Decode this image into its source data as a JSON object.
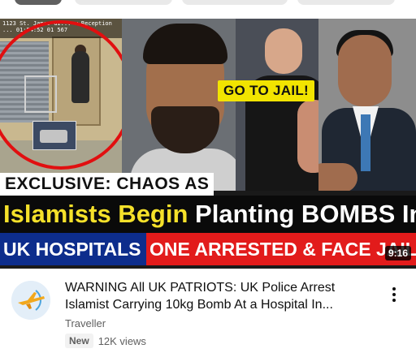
{
  "thumbnail": {
    "timestamp_overlay": "1123 St. James Gi... w Reception\n... 01:54:52 01 567",
    "speech_bubble": "GO TO JAIL!",
    "headline_line1": "EXCLUSIVE: CHAOS AS",
    "headline_line2_yellow": "Islamists Begin",
    "headline_line2_white": "Planting BOMBS In",
    "headline_line3_blue": "UK HOSPITALS -",
    "headline_line3_red": "ONE ARRESTED & FACE JAIL",
    "duration": "9:16",
    "colors": {
      "circle": "#e10f10",
      "bubble": "#f2e400",
      "blue_band": "#0d2d8c",
      "red_band": "#e21b1b",
      "yellow_text": "#f5e12a"
    }
  },
  "video": {
    "title_line1": "WARNING All UK PATRIOTS: UK Police Arrest",
    "title_line2": "Islamist Carrying 10kg Bomb At a Hospital In...",
    "channel": "Traveller",
    "badge": "New",
    "views": "12K views",
    "avatar_icon": "airplane-logo-icon",
    "menu_icon": "more-vert-icon"
  }
}
